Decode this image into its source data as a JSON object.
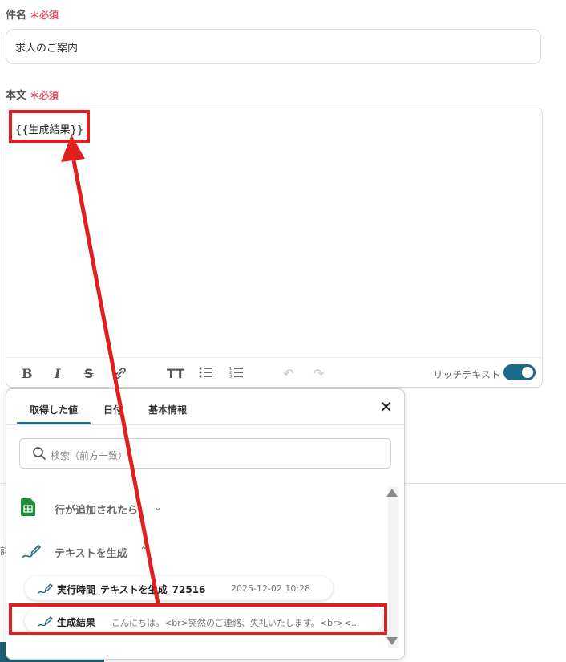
{
  "subject": {
    "label": "件名",
    "required_mark": "＊",
    "required_text": "必須",
    "value": "求人のご案内"
  },
  "body": {
    "label": "本文",
    "required_mark": "＊",
    "required_text": "必須",
    "value": "{{生成結果}}",
    "rich_text_label": "リッチテキスト",
    "rich_text_enabled": true
  },
  "picker": {
    "tabs": [
      "取得した値",
      "日付",
      "基本情報"
    ],
    "active_tab": 0,
    "search_placeholder": "検索（前方一致）",
    "sections": [
      {
        "label": "行が追加されたら",
        "icon": "google-sheets-icon",
        "expanded": false
      },
      {
        "label": "テキストを生成",
        "icon": "ai-pen-icon",
        "expanded": true
      }
    ],
    "items": [
      {
        "name": "実行時間_テキストを生成_72516",
        "value": "2025-12-02 10:28"
      },
      {
        "name": "生成結果",
        "value": "こんにちは。<br>突然のご連絡、失礼いたします。<br><..."
      }
    ]
  },
  "colors": {
    "accent": "#1e6a83",
    "required": "#e0566a",
    "annotation": "#e02020",
    "sheets_green": "#1e8e3e"
  }
}
